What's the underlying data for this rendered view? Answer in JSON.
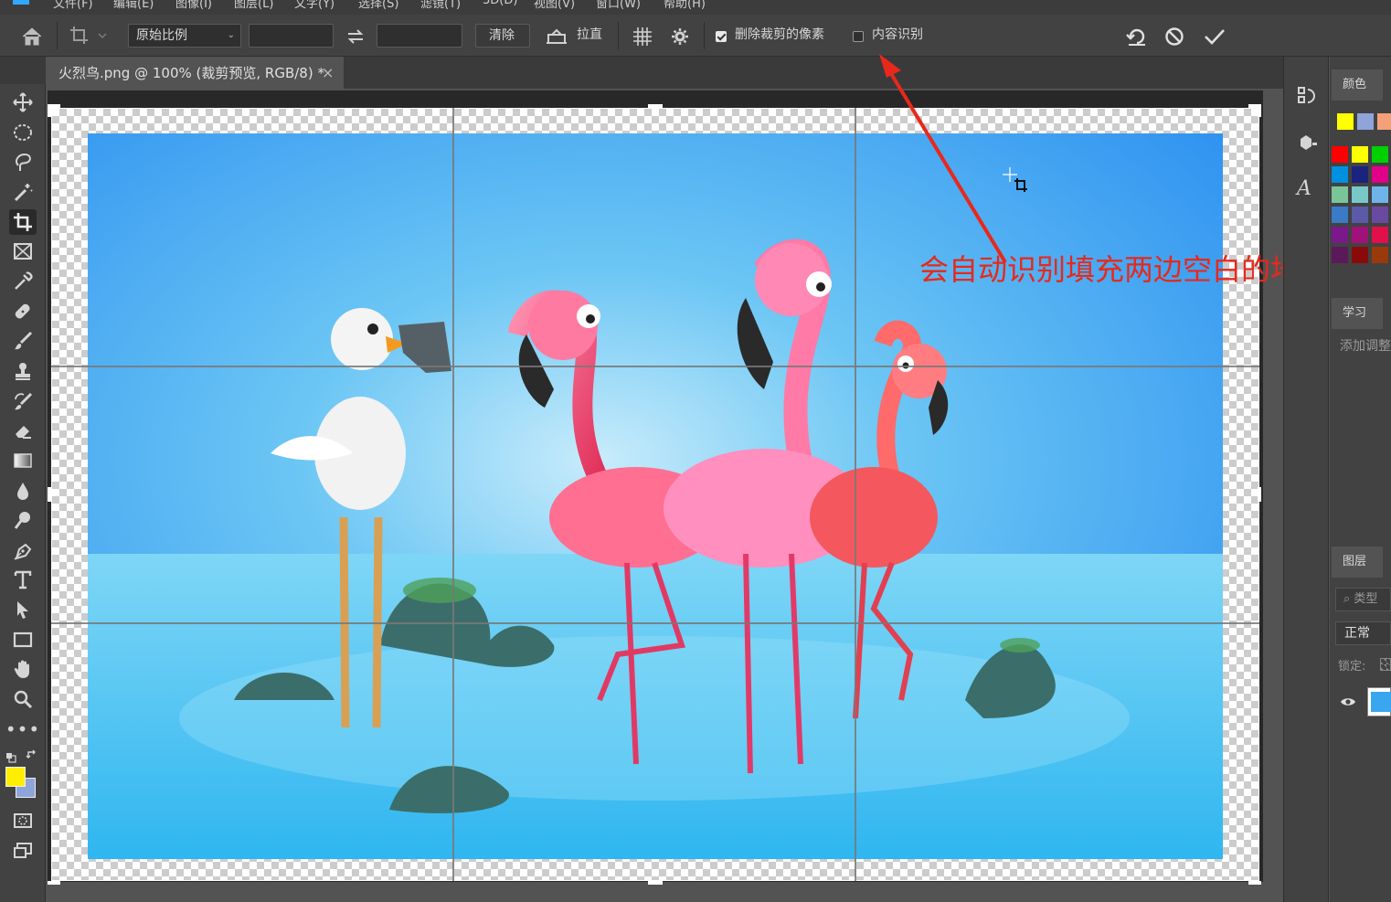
{
  "menu": [
    "文件(F)",
    "编辑(E)",
    "图像(I)",
    "图层(L)",
    "文字(Y)",
    "选择(S)",
    "滤镜(T)",
    "3D(D)",
    "视图(V)",
    "窗口(W)",
    "帮助(H)"
  ],
  "options": {
    "ratio_select": "原始比例",
    "width_value": "",
    "height_value": "",
    "clear_label": "清除",
    "straighten_label": "拉直",
    "delete_cropped_label": "删除裁剪的像素",
    "delete_cropped_checked": true,
    "content_aware_label": "内容识别",
    "content_aware_checked": false
  },
  "document": {
    "tab_title": "火烈鸟.png @ 100% (裁剪预览, RGB/8) *",
    "close_glyph": "×"
  },
  "annotation": {
    "text": "会自动识别填充两边空白的地方",
    "color": "#e8281b"
  },
  "right_panel": {
    "color_tab": "颜色",
    "learn_tab": "学习",
    "adjust_label": "添加调整",
    "layers_tab": "图层",
    "search_placeholder": "类型",
    "blend_mode": "正常",
    "lock_label": "锁定:"
  },
  "swatches": [
    "#ffff00",
    "#8fa4d8",
    "#f4a07a",
    "#ff0000",
    "#ffff00",
    "#00d000",
    "#0090e0",
    "#1a237e",
    "#e0008a",
    "#7ac49a",
    "#78c8c8",
    "#6fb4e8",
    "#3a7bc8",
    "#5a5aa8",
    "#6a4aa0",
    "#7a1a8a",
    "#a0127a",
    "#e0104a",
    "#5a1a5a",
    "#8a0a0a",
    "#9a3a0a"
  ],
  "colors": {
    "foreground": "#ffee00",
    "background": "#8fa4d8"
  }
}
